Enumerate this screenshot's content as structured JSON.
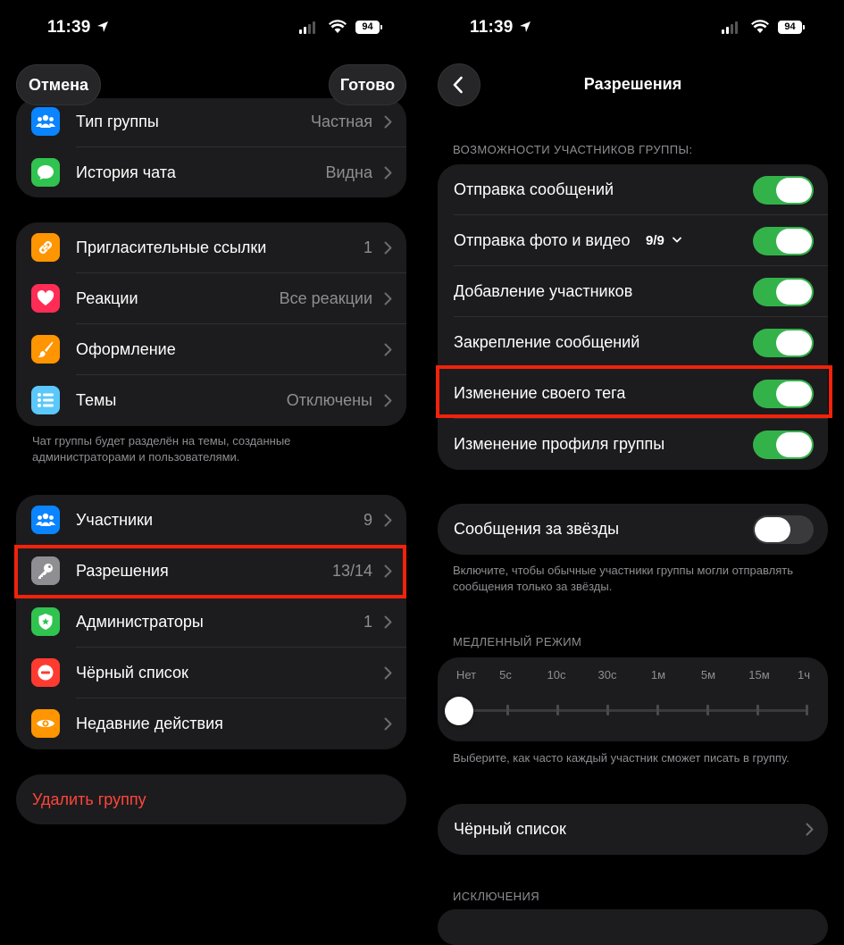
{
  "status_left": {
    "time": "11:39",
    "battery": "94"
  },
  "status_right": {
    "time": "11:39",
    "battery": "94"
  },
  "left": {
    "cancel_label": "Отмена",
    "done_label": "Готово",
    "group1": [
      {
        "label": "Тип группы",
        "value": "Частная",
        "icon": "people-icon",
        "color": "#0a84ff"
      },
      {
        "label": "История чата",
        "value": "Видна",
        "icon": "chat-bubble-icon",
        "color": "#30c34f"
      }
    ],
    "group2": [
      {
        "label": "Пригласительные ссылки",
        "value": "1",
        "icon": "link-icon",
        "color": "#ff9500"
      },
      {
        "label": "Реакции",
        "value": "Все реакции",
        "icon": "heart-icon",
        "color": "#ff2d55"
      },
      {
        "label": "Оформление",
        "value": "",
        "icon": "brush-icon",
        "color": "#ff9500"
      },
      {
        "label": "Темы",
        "value": "Отключены",
        "icon": "topics-list-icon",
        "color": "#5ac8fa"
      }
    ],
    "group2_footnote": "Чат группы будет разделён на темы, созданные администраторами и пользователями.",
    "group3": [
      {
        "label": "Участники",
        "value": "9",
        "icon": "people-icon",
        "color": "#0a84ff"
      },
      {
        "label": "Разрешения",
        "value": "13/14",
        "icon": "key-icon",
        "color": "#8e8e93"
      },
      {
        "label": "Администраторы",
        "value": "1",
        "icon": "shield-icon",
        "color": "#30c34f"
      },
      {
        "label": "Чёрный список",
        "value": "",
        "icon": "minus-circle-icon",
        "color": "#ff3b30"
      },
      {
        "label": "Недавние действия",
        "value": "",
        "icon": "eye-icon",
        "color": "#ff9500"
      }
    ],
    "delete_label": "Удалить группу"
  },
  "right": {
    "title": "Разрешения",
    "members_header": "ВОЗМОЖНОСТИ УЧАСТНИКОВ ГРУППЫ:",
    "permissions": [
      {
        "label": "Отправка сообщений",
        "on": true
      },
      {
        "label": "Отправка фото и видео",
        "badge": "9/9",
        "on": true
      },
      {
        "label": "Добавление участников",
        "on": true
      },
      {
        "label": "Закрепление сообщений",
        "on": true
      },
      {
        "label": "Изменение своего тега",
        "on": true
      },
      {
        "label": "Изменение профиля группы",
        "on": true
      }
    ],
    "stars_label": "Сообщения за звёзды",
    "stars_on": false,
    "stars_footnote": "Включите, чтобы обычные участники группы могли отправлять сообщения только за звёзды.",
    "slowmode_header": "МЕДЛЕННЫЙ РЕЖИМ",
    "slowmode_options": [
      "Нет",
      "5с",
      "10с",
      "30с",
      "1м",
      "5м",
      "15м",
      "1ч"
    ],
    "slowmode_selected": "Нет",
    "slowmode_footnote": "Выберите, как часто каждый участник сможет писать в группу.",
    "blacklist_label": "Чёрный список",
    "exceptions_header": "ИСКЛЮЧЕНИЯ"
  },
  "colors": {
    "accent_green": "#34b24a",
    "highlight_red": "#f2220b",
    "destructive": "#ff453a"
  }
}
